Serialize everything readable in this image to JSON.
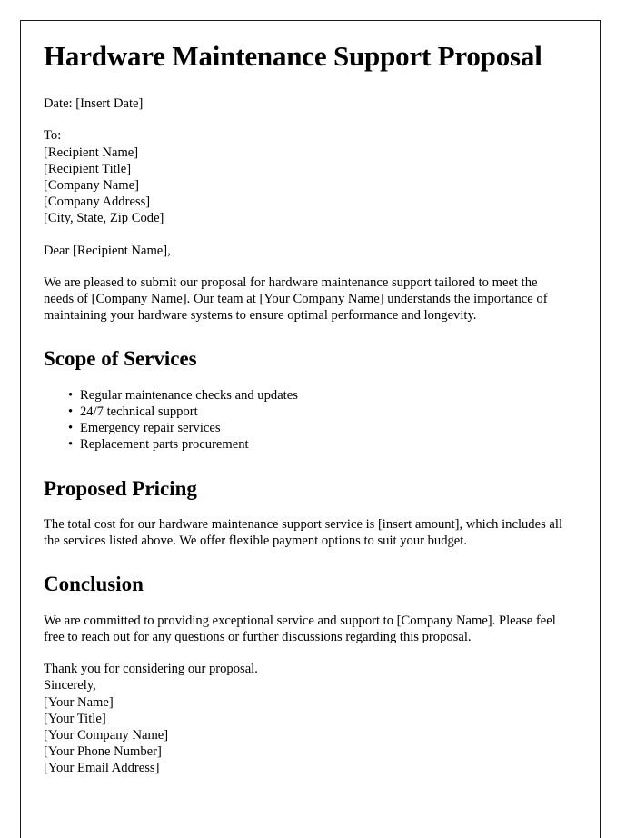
{
  "document": {
    "title": "Hardware Maintenance Support Proposal",
    "date_line": "Date: [Insert Date]",
    "recipient_block": {
      "label": "To:",
      "lines": [
        "[Recipient Name]",
        "[Recipient Title]",
        "[Company Name]",
        "[Company Address]",
        "[City, State, Zip Code]"
      ]
    },
    "salutation": "Dear [Recipient Name],",
    "intro_paragraph": "We are pleased to submit our proposal for hardware maintenance support tailored to meet the needs of [Company Name]. Our team at [Your Company Name] understands the importance of maintaining your hardware systems to ensure optimal performance and longevity.",
    "sections": {
      "scope": {
        "heading": "Scope of Services",
        "items": [
          "Regular maintenance checks and updates",
          "24/7 technical support",
          "Emergency repair services",
          "Replacement parts procurement"
        ]
      },
      "pricing": {
        "heading": "Proposed Pricing",
        "paragraph": "The total cost for our hardware maintenance support service is [insert amount], which includes all the services listed above. We offer flexible payment options to suit your budget."
      },
      "conclusion": {
        "heading": "Conclusion",
        "paragraph": "We are committed to providing exceptional service and support to [Company Name]. Please feel free to reach out for any questions or further discussions regarding this proposal."
      }
    },
    "closing_block": {
      "thank_you": "Thank you for considering our proposal.",
      "sign_off": "Sincerely,",
      "signature_lines": [
        "[Your Name]",
        "[Your Title]",
        "[Your Company Name]",
        "[Your Phone Number]",
        "[Your Email Address]"
      ]
    },
    "bullet_glyph": "•"
  }
}
